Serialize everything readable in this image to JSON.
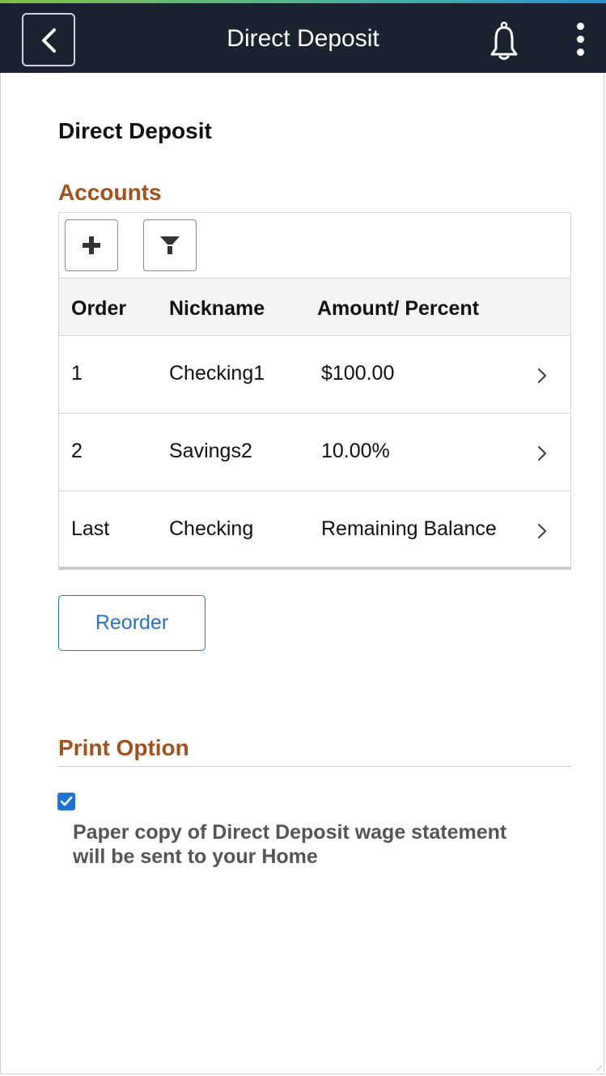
{
  "header": {
    "title": "Direct Deposit"
  },
  "page": {
    "title": "Direct Deposit"
  },
  "accounts": {
    "heading": "Accounts",
    "columns": {
      "order": "Order",
      "nickname": "Nickname",
      "amount": "Amount/ Percent"
    },
    "rows": [
      {
        "order": "1",
        "nickname": "Checking1",
        "amount": "$100.00"
      },
      {
        "order": "2",
        "nickname": "Savings2",
        "amount": "10.00%"
      },
      {
        "order": "Last",
        "nickname": "Checking",
        "amount": "Remaining Balance"
      }
    ],
    "reorder_label": "Reorder"
  },
  "print_option": {
    "heading": "Print Option",
    "checked": true,
    "text": "Paper copy of Direct Deposit wage statement will be sent to your Home"
  },
  "colors": {
    "header_bg": "#1c2330",
    "section_heading": "#a1521c",
    "link_blue": "#2a73bd",
    "checkbox_blue": "#1e73d8"
  },
  "icons": {
    "back": "chevron-left-icon",
    "notifications": "bell-icon",
    "menu": "kebab-menu-icon",
    "add": "plus-icon",
    "filter": "filter-icon",
    "row_detail": "chevron-right-icon",
    "checkbox": "checkmark-icon"
  }
}
